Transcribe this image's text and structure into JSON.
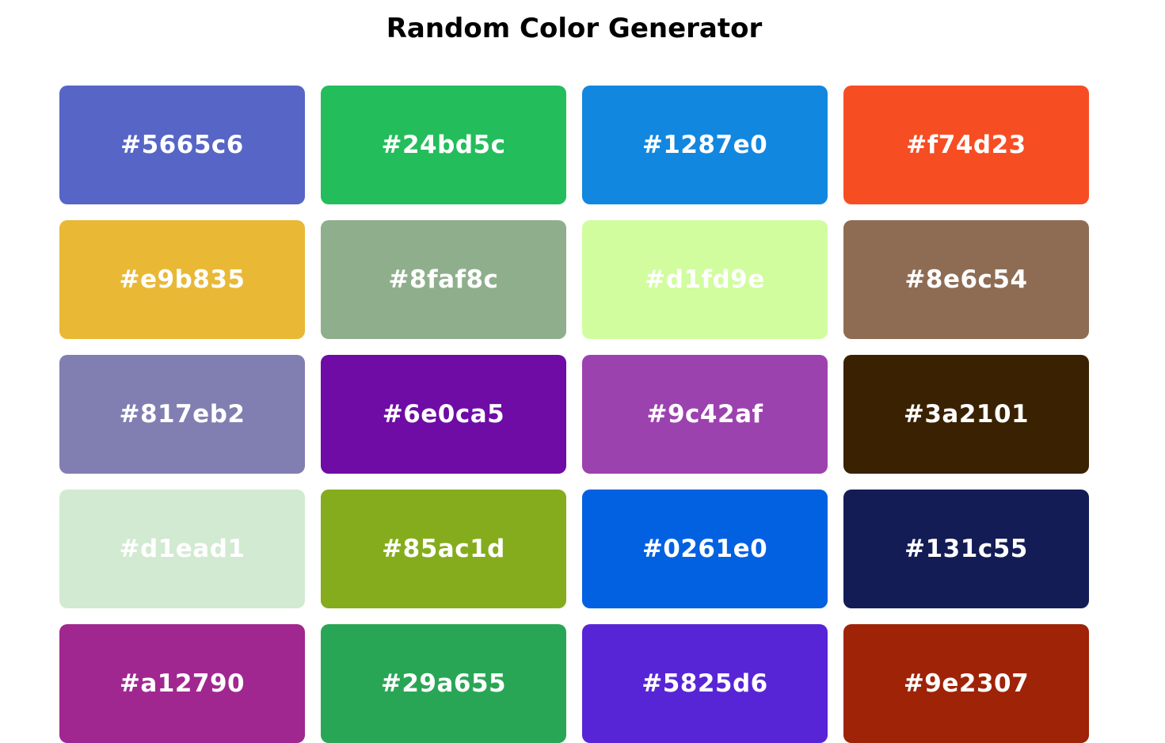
{
  "header": {
    "title": "Random Color Generator"
  },
  "swatches": [
    {
      "color": "#5665c6",
      "label": "#5665c6"
    },
    {
      "color": "#24bd5c",
      "label": "#24bd5c"
    },
    {
      "color": "#1287e0",
      "label": "#1287e0"
    },
    {
      "color": "#f74d23",
      "label": "#f74d23"
    },
    {
      "color": "#e9b835",
      "label": "#e9b835"
    },
    {
      "color": "#8faf8c",
      "label": "#8faf8c"
    },
    {
      "color": "#d1fd9e",
      "label": "#d1fd9e"
    },
    {
      "color": "#8e6c54",
      "label": "#8e6c54"
    },
    {
      "color": "#817eb2",
      "label": "#817eb2"
    },
    {
      "color": "#6e0ca5",
      "label": "#6e0ca5"
    },
    {
      "color": "#9c42af",
      "label": "#9c42af"
    },
    {
      "color": "#3a2101",
      "label": "#3a2101"
    },
    {
      "color": "#d1ead1",
      "label": "#d1ead1"
    },
    {
      "color": "#85ac1d",
      "label": "#85ac1d"
    },
    {
      "color": "#0261e0",
      "label": "#0261e0"
    },
    {
      "color": "#131c55",
      "label": "#131c55"
    },
    {
      "color": "#a12790",
      "label": "#a12790"
    },
    {
      "color": "#29a655",
      "label": "#29a655"
    },
    {
      "color": "#5825d6",
      "label": "#5825d6"
    },
    {
      "color": "#9e2307",
      "label": "#9e2307"
    }
  ]
}
